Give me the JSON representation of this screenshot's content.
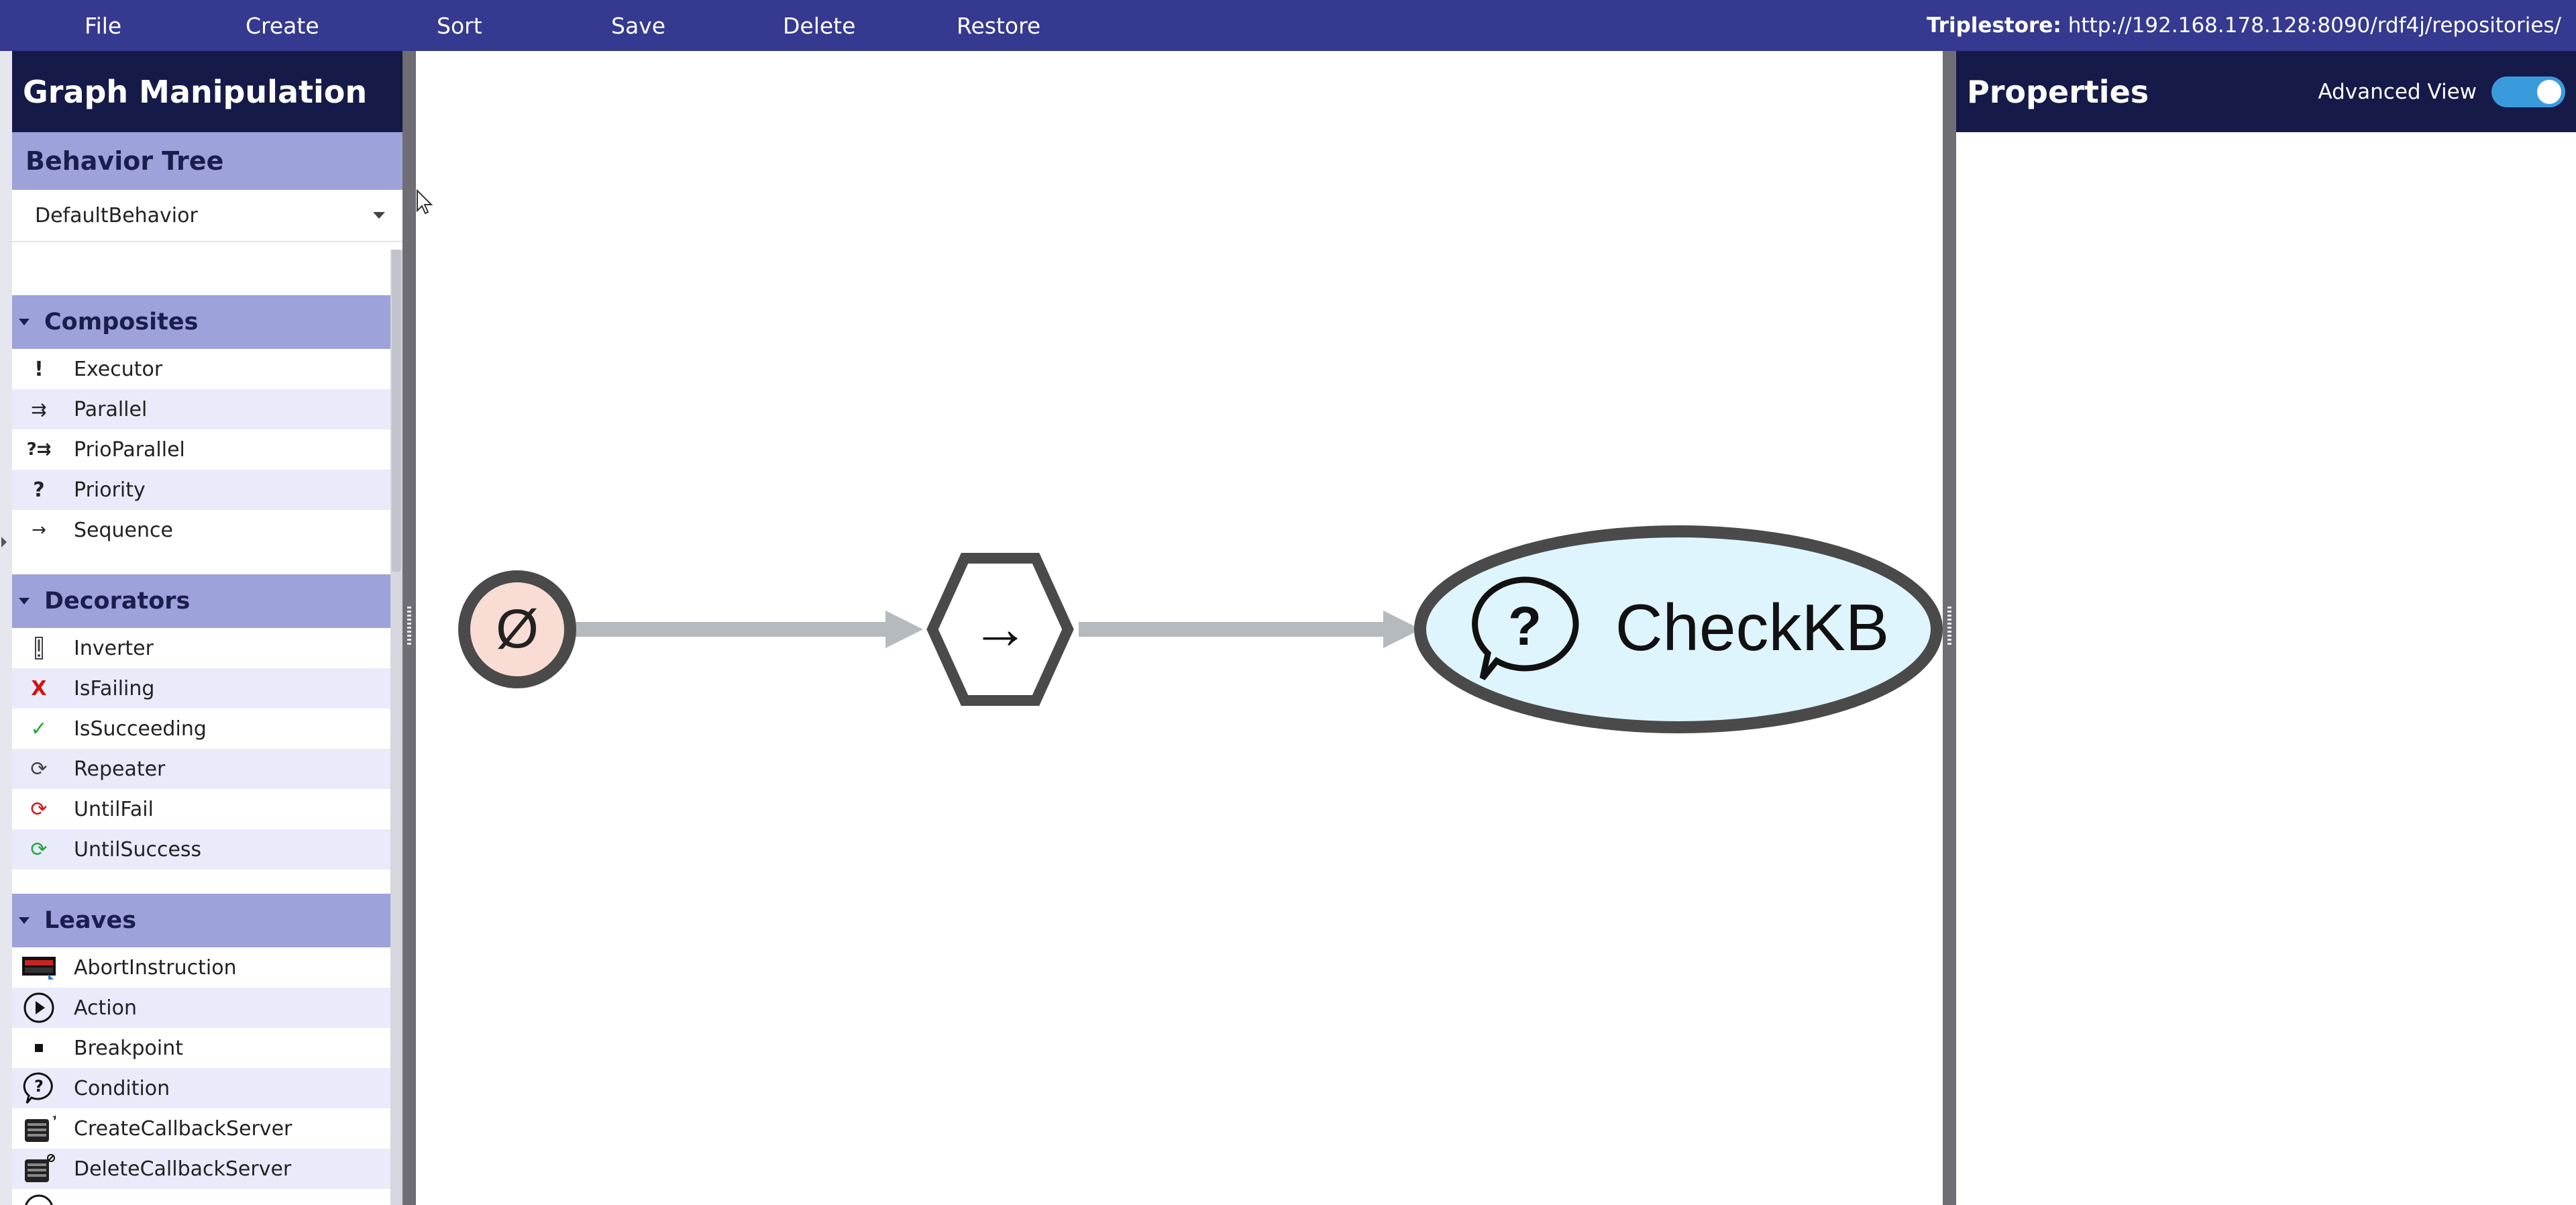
{
  "menubar": {
    "items": [
      {
        "label": "File"
      },
      {
        "label": "Create"
      },
      {
        "label": "Sort"
      },
      {
        "label": "Save"
      },
      {
        "label": "Delete"
      },
      {
        "label": "Restore"
      }
    ],
    "triplestore_label": "Triplestore:",
    "triplestore_url": "http://192.168.178.128:8090/rdf4j/repositories/"
  },
  "left_panel": {
    "title": "Graph Manipulation",
    "behavior_tree_label": "Behavior Tree",
    "selected_tree": "DefaultBehavior",
    "sections": {
      "composites": {
        "label": "Composites",
        "items": [
          {
            "label": "Executor",
            "icon": "exclamation-icon"
          },
          {
            "label": "Parallel",
            "icon": "parallel-arrows-icon"
          },
          {
            "label": "PrioParallel",
            "icon": "prio-parallel-icon"
          },
          {
            "label": "Priority",
            "icon": "question-mark-icon"
          },
          {
            "label": "Sequence",
            "icon": "arrow-right-icon"
          }
        ]
      },
      "decorators": {
        "label": "Decorators",
        "items": [
          {
            "label": "Inverter",
            "icon": "inverter-icon"
          },
          {
            "label": "IsFailing",
            "icon": "red-x-icon"
          },
          {
            "label": "IsSucceeding",
            "icon": "green-check-icon"
          },
          {
            "label": "Repeater",
            "icon": "repeat-icon"
          },
          {
            "label": "UntilFail",
            "icon": "repeat-red-icon"
          },
          {
            "label": "UntilSuccess",
            "icon": "repeat-green-icon"
          }
        ]
      },
      "leaves": {
        "label": "Leaves",
        "items": [
          {
            "label": "AbortInstruction",
            "icon": "abort-instruction-icon"
          },
          {
            "label": "Action",
            "icon": "play-circle-icon"
          },
          {
            "label": "Breakpoint",
            "icon": "breakpoint-icon"
          },
          {
            "label": "Condition",
            "icon": "question-bubble-icon"
          },
          {
            "label": "CreateCallbackServer",
            "icon": "create-server-icon"
          },
          {
            "label": "DeleteCallbackServer",
            "icon": "delete-server-icon"
          }
        ]
      }
    }
  },
  "graph": {
    "root_symbol": "Ø",
    "sequence_symbol": "→",
    "leaf_label": "CheckKB",
    "colors": {
      "root_fill": "#f9dcd4",
      "leaf_fill": "#dff5fd",
      "node_stroke": "#4a4a4a",
      "edge": "#b5babe"
    }
  },
  "right_panel": {
    "title": "Properties",
    "advanced_view_label": "Advanced View",
    "advanced_view_on": true
  },
  "colors": {
    "menubar": "#35398f",
    "panel_header": "#161a48",
    "section_header": "#9ea2da",
    "row_alt": "#e9eafa",
    "toggle_on": "#3a9bdc"
  }
}
